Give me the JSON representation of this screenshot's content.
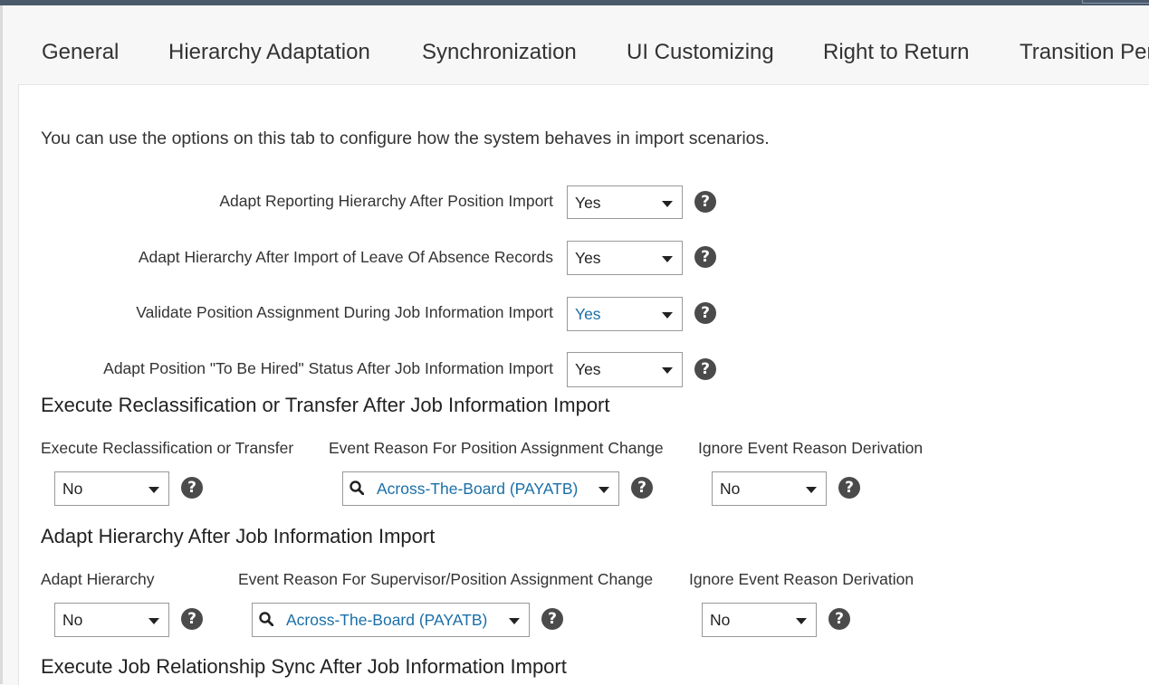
{
  "tabs": [
    "General",
    "Hierarchy Adaptation",
    "Synchronization",
    "UI Customizing",
    "Right to Return",
    "Transition Per"
  ],
  "intro": "You can use the options on this tab to configure how the system behaves in import scenarios.",
  "rows": [
    {
      "label": "Adapt Reporting Hierarchy After Position Import",
      "value": "Yes"
    },
    {
      "label": "Adapt Hierarchy After Import of Leave Of Absence Records",
      "value": "Yes"
    },
    {
      "label": "Validate Position Assignment During Job Information Import",
      "value": "Yes"
    },
    {
      "label": "Adapt Position \"To Be Hired\" Status After Job Information Import",
      "value": "Yes"
    }
  ],
  "help_glyph": "?",
  "sections": [
    {
      "title": "Execute Reclassification or Transfer After Job Information Import",
      "fields": [
        {
          "label": "Execute Reclassification or Transfer",
          "value": "No"
        },
        {
          "label": "Event Reason For Position Assignment Change",
          "value": "Across-The-Board (PAYATB)"
        },
        {
          "label": "Ignore Event Reason Derivation",
          "value": "No"
        }
      ]
    },
    {
      "title": "Adapt Hierarchy After Job Information Import",
      "fields": [
        {
          "label": "Adapt Hierarchy",
          "value": "No"
        },
        {
          "label": "Event Reason For Supervisor/Position Assignment Change",
          "value": "Across-The-Board (PAYATB)"
        },
        {
          "label": "Ignore Event Reason Derivation",
          "value": "No"
        }
      ]
    },
    {
      "title": "Execute Job Relationship Sync After Job Information Import"
    }
  ],
  "colors": {
    "link": "#1a6fa8",
    "help_bg": "#4b4b4b",
    "topbar": "#4a5a6a"
  },
  "icons": {
    "help": "question-circle-icon",
    "search": "magnifier-icon",
    "dropdown": "caret-down-icon"
  }
}
